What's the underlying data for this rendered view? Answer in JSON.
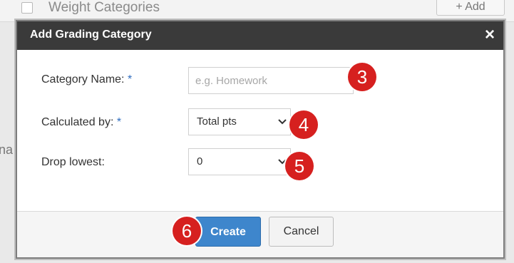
{
  "background": {
    "title": "Weight Categories",
    "add_button": "+ Add",
    "left_fragment": "na"
  },
  "dialog": {
    "title": "Add Grading Category",
    "close_glyph": "×",
    "fields": {
      "category_name": {
        "label": "Category Name:",
        "required": "*",
        "placeholder": "e.g. Homework",
        "value": ""
      },
      "calculated_by": {
        "label": "Calculated by:",
        "required": "*",
        "value": "Total pts"
      },
      "drop_lowest": {
        "label": "Drop lowest:",
        "value": "0"
      }
    },
    "buttons": {
      "create": "Create",
      "cancel": "Cancel"
    }
  },
  "annotations": [
    "3",
    "4",
    "5",
    "6"
  ],
  "colors": {
    "header_bg": "#3a3a3a",
    "primary_button": "#3e86cc",
    "required_marker": "#2f6dbf",
    "annotation_badge": "#d6201f"
  },
  "icons": {
    "close": "close-icon",
    "dropdown": "chevron-down-icon",
    "checkbox": "checkbox-icon"
  }
}
